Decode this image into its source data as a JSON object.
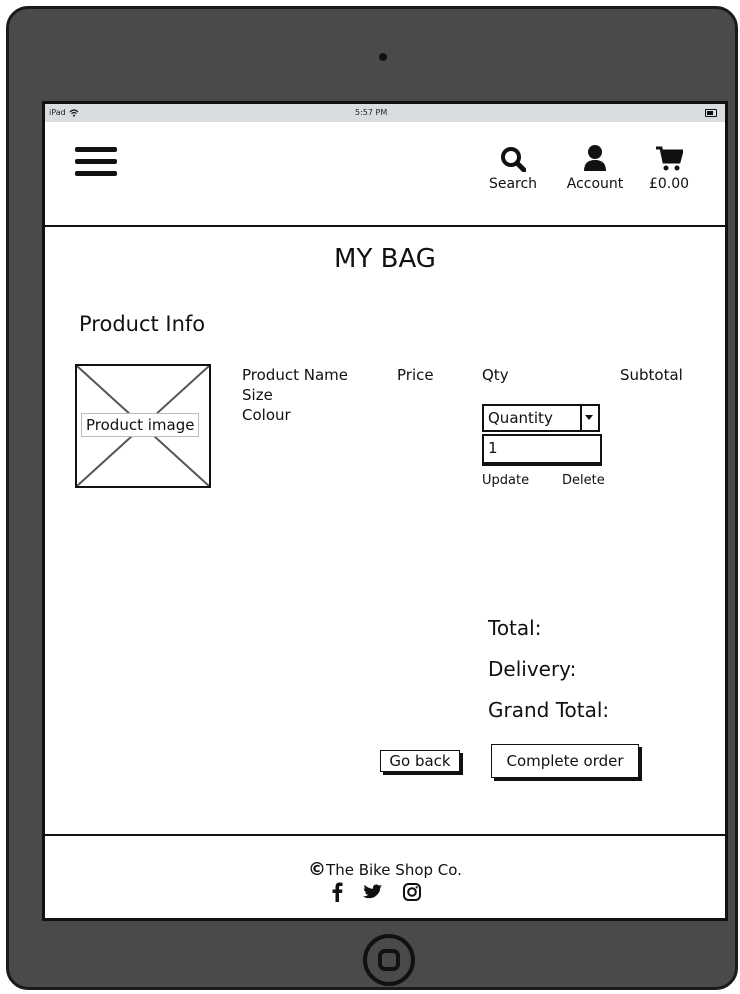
{
  "statusbar": {
    "device": "iPad",
    "time": "5:57 PM"
  },
  "header": {
    "search_label": "Search",
    "account_label": "Account",
    "bag_total": "£0.00"
  },
  "page": {
    "title": "MY BAG",
    "section_title": "Product Info"
  },
  "product": {
    "image_label": "Product image",
    "name_label": "Product Name",
    "size_label": "Size",
    "colour_label": "Colour",
    "price_header": "Price",
    "qty_header": "Qty",
    "subtotal_header": "Subtotal",
    "quantity_select_value": "Quantity",
    "quantity_value": "1",
    "update_label": "Update",
    "delete_label": "Delete"
  },
  "summary": {
    "total_label": "Total:",
    "delivery_label": "Delivery:",
    "grand_total_label": "Grand Total:"
  },
  "actions": {
    "go_back_label": "Go back",
    "complete_order_label": "Complete order"
  },
  "footer": {
    "copyright_symbol": "©",
    "copyright_text": "The Bike Shop Co.",
    "icons": [
      "facebook-icon",
      "twitter-icon",
      "instagram-icon"
    ]
  },
  "colors": {
    "frame": "#4a4a4a",
    "statusbar": "#d9dde0",
    "ink": "#111111"
  }
}
